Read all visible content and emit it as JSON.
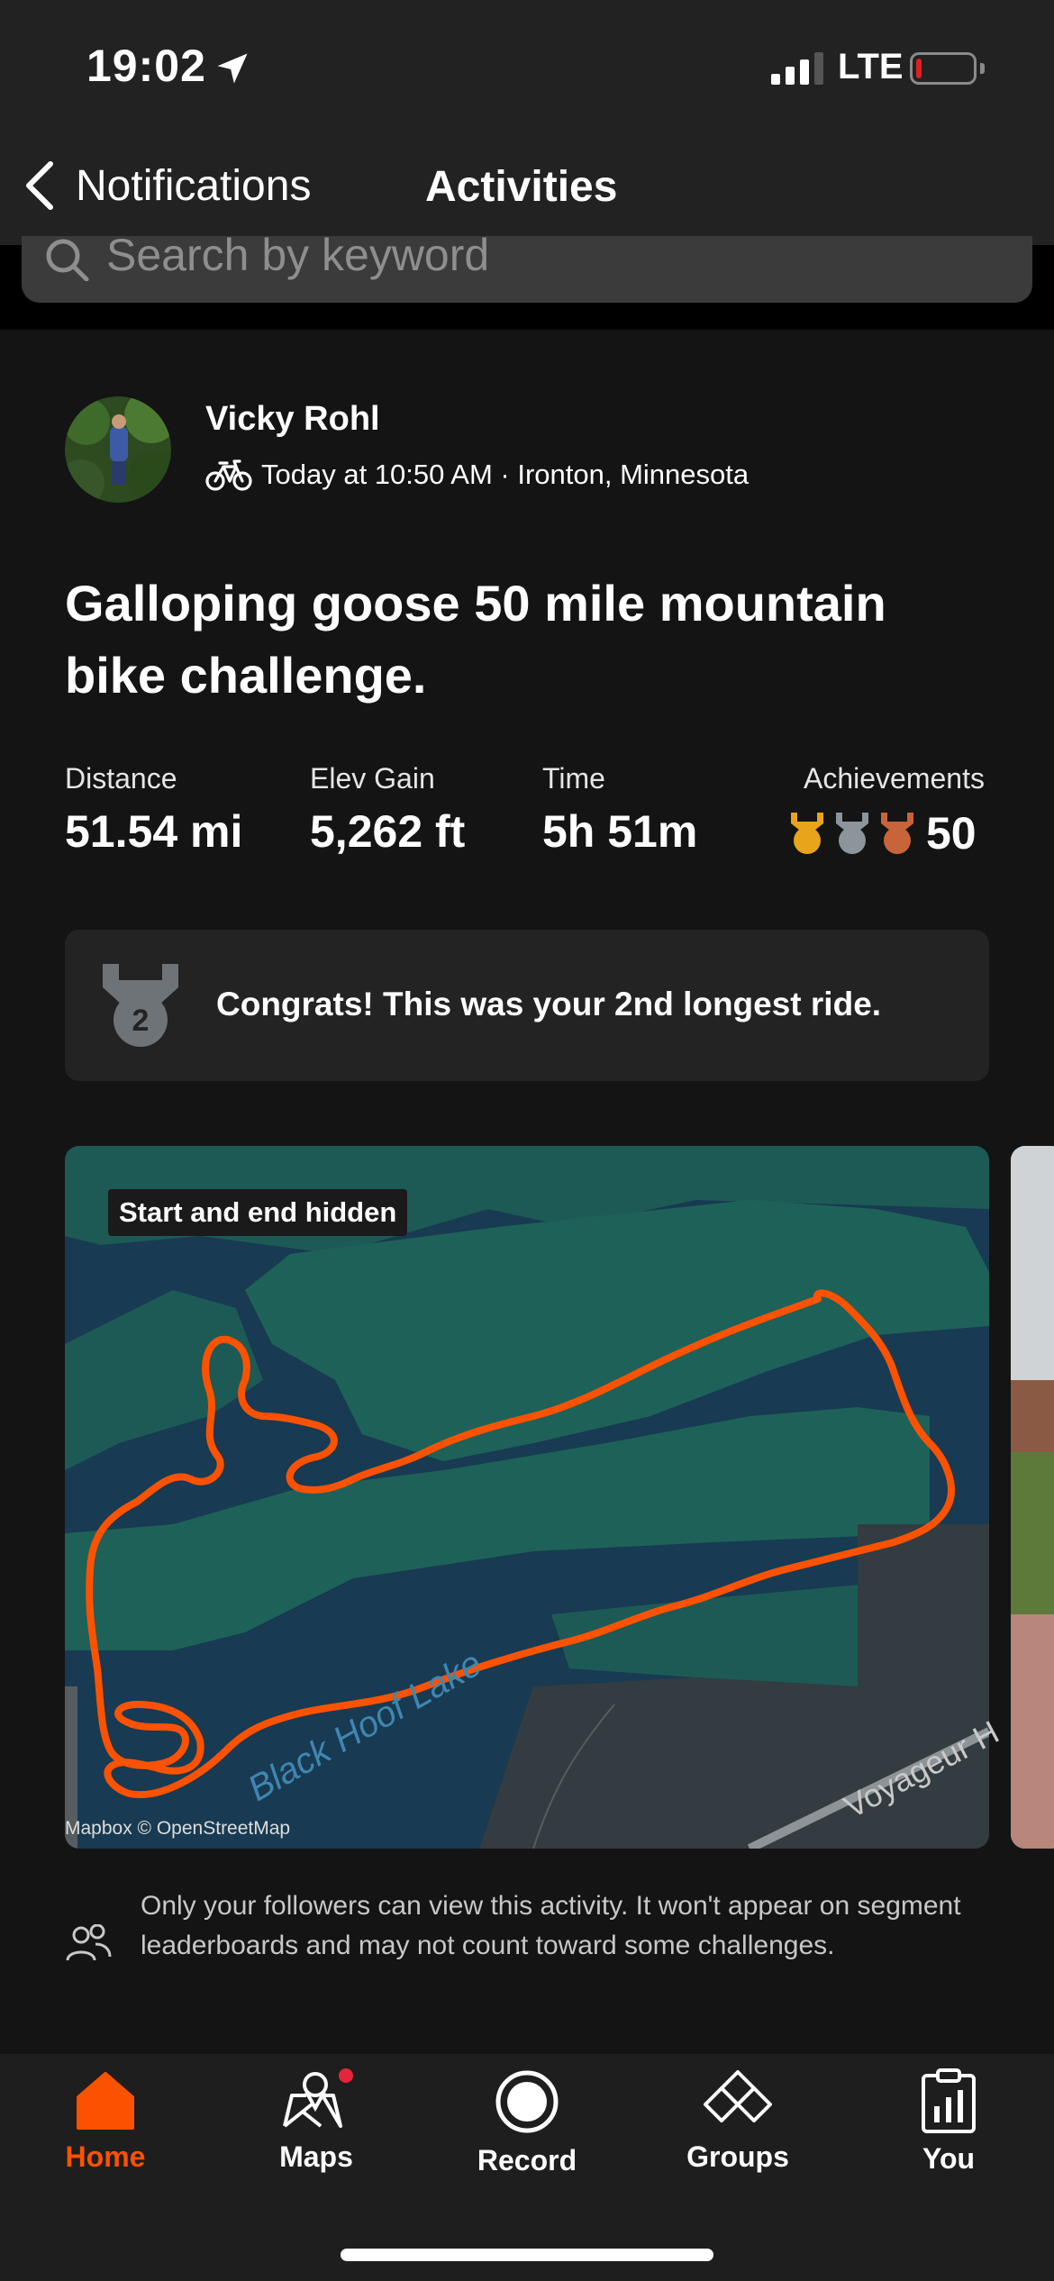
{
  "status_bar": {
    "time": "19:02",
    "network": "LTE",
    "battery_color": "#e02020"
  },
  "nav": {
    "back_label": "Notifications",
    "title": "Activities"
  },
  "search": {
    "placeholder": "Search by keyword"
  },
  "activity": {
    "user_name": "Vicky Rohl",
    "sport_icon": "bike-icon",
    "meta": "Today at 10:50 AM · Ironton, Minnesota",
    "title": "Galloping goose 50 mile mountain bike challenge.",
    "stats": [
      {
        "label": "Distance",
        "value": "51.54 mi"
      },
      {
        "label": "Elev Gain",
        "value": "5,262 ft"
      },
      {
        "label": "Time",
        "value": "5h 51m"
      },
      {
        "label": "Achievements",
        "value": "50"
      }
    ],
    "achievement_colors": [
      "#e8a41a",
      "#8c959b",
      "#c8643a"
    ],
    "congrats": {
      "text": "Congrats! This was your 2nd longest ride.",
      "medal_number": "2"
    },
    "map": {
      "badge": "Start and end hidden",
      "credit": "Mapbox © OpenStreetMap",
      "lake_label": "Black Hoof Lake",
      "road_label": "Voyageur H",
      "route_color": "#fc5200"
    },
    "privacy_text": "Only your followers can view this activity. It won't appear on segment leaderboards and may not count toward some challenges."
  },
  "tabs": [
    {
      "label": "Home",
      "icon": "home-icon",
      "active": true
    },
    {
      "label": "Maps",
      "icon": "map-icon",
      "badge": true
    },
    {
      "label": "Record",
      "icon": "record-icon"
    },
    {
      "label": "Groups",
      "icon": "groups-icon"
    },
    {
      "label": "You",
      "icon": "clipboard-icon"
    }
  ],
  "colors": {
    "accent": "#fc5200",
    "badge_dot": "#e8243a"
  }
}
